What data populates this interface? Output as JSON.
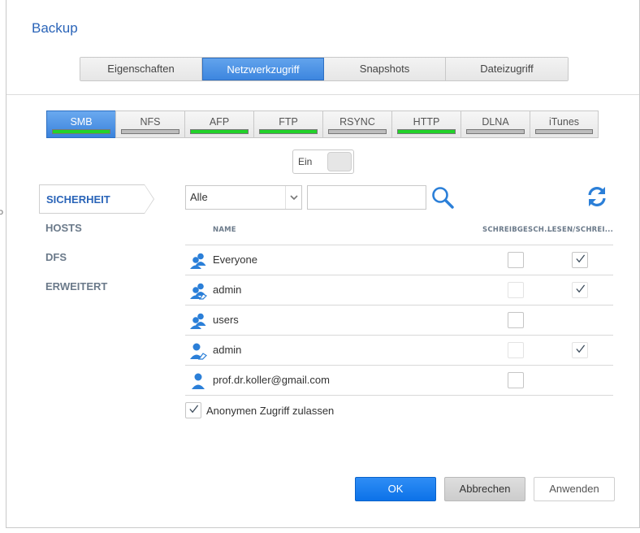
{
  "window": {
    "title": "Backup"
  },
  "main_tabs": [
    {
      "label": "Eigenschaften",
      "active": false
    },
    {
      "label": "Netzwerkzugriff",
      "active": true
    },
    {
      "label": "Snapshots",
      "active": false
    },
    {
      "label": "Dateizugriff",
      "active": false
    }
  ],
  "protocols": [
    {
      "label": "SMB",
      "active": true,
      "status": "enabled",
      "color": "#22d22a"
    },
    {
      "label": "NFS",
      "active": false,
      "status": "disabled",
      "color": "#bdbdbd"
    },
    {
      "label": "AFP",
      "active": false,
      "status": "enabled",
      "color": "#22d22a"
    },
    {
      "label": "FTP",
      "active": false,
      "status": "enabled",
      "color": "#22d22a"
    },
    {
      "label": "RSYNC",
      "active": false,
      "status": "disabled",
      "color": "#bdbdbd"
    },
    {
      "label": "HTTP",
      "active": false,
      "status": "enabled",
      "color": "#22d22a"
    },
    {
      "label": "DLNA",
      "active": false,
      "status": "disabled",
      "color": "#bdbdbd"
    },
    {
      "label": "iTunes",
      "active": false,
      "status": "disabled",
      "color": "#bdbdbd"
    }
  ],
  "toggle": {
    "label": "Ein"
  },
  "sidenav": [
    {
      "label": "SICHERHEIT",
      "active": true
    },
    {
      "label": "HOSTS",
      "active": false
    },
    {
      "label": "DFS",
      "active": false
    },
    {
      "label": "ERWEITERT",
      "active": false
    }
  ],
  "filter": {
    "selected": "Alle",
    "search_value": ""
  },
  "table": {
    "headers": {
      "name": "NAME",
      "readonly": "SCHREIBGESCH...",
      "readwrite": "LESEN/SCHREI..."
    },
    "rows": [
      {
        "name": "Everyone",
        "icon": "group-icon",
        "readonly": false,
        "readonly_enabled": true,
        "readwrite": true,
        "readwrite_enabled": true
      },
      {
        "name": "admin",
        "icon": "admin-group-icon",
        "readonly": false,
        "readonly_enabled": false,
        "readwrite": true,
        "readwrite_enabled": false
      },
      {
        "name": "users",
        "icon": "group-icon",
        "readonly": false,
        "readonly_enabled": true,
        "readwrite": false,
        "readwrite_enabled": false
      },
      {
        "name": "admin",
        "icon": "admin-user-icon",
        "readonly": false,
        "readonly_enabled": false,
        "readwrite": true,
        "readwrite_enabled": false
      },
      {
        "name": "prof.dr.koller@gmail.com",
        "icon": "user-icon",
        "readonly": false,
        "readonly_enabled": true,
        "readwrite": false,
        "readwrite_enabled": false
      }
    ]
  },
  "anonymous": {
    "label": "Anonymen Zugriff zulassen",
    "checked": true
  },
  "buttons": {
    "ok": "OK",
    "cancel": "Abbrechen",
    "apply": "Anwenden"
  },
  "colors": {
    "accent": "#2a64b8",
    "primary_button": "#1a7ef0",
    "icon_blue": "#2b7fd8"
  }
}
